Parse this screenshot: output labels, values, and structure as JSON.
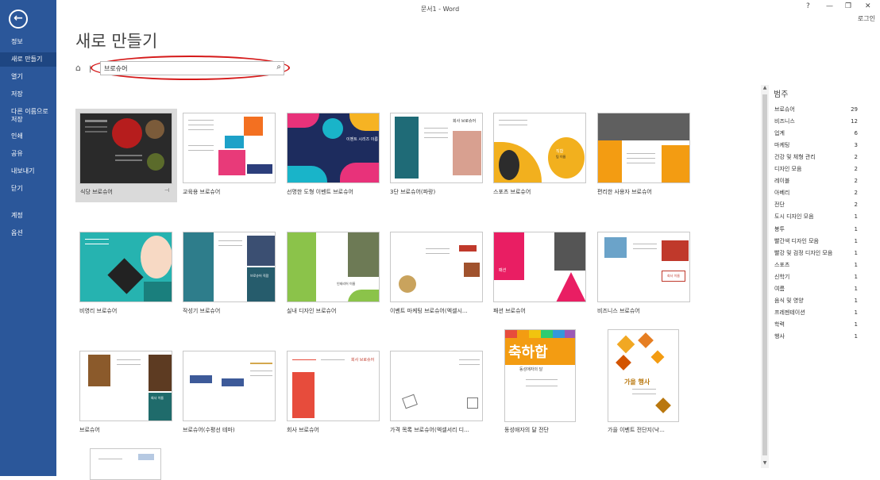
{
  "window": {
    "title": "문서1 - Word",
    "help": "?",
    "minimize": "—",
    "restore": "❐",
    "close": "✕",
    "login": "로그인"
  },
  "sidebar": {
    "back_icon": "←",
    "items": [
      "정보",
      "새로 만들기",
      "열기",
      "저장",
      "다른 이름으로",
      "저장",
      "인쇄",
      "공유",
      "내보내기",
      "닫기",
      "계정",
      "옵션"
    ]
  },
  "page": {
    "title": "새로 만들기",
    "home_icon": "⌂",
    "home_sep": "ㅣ"
  },
  "search": {
    "value": "브로슈어",
    "icon": "⌕"
  },
  "templates": [
    {
      "label": "식당 브로슈어",
      "pin": "⊣"
    },
    {
      "label": "교육용 브로슈어"
    },
    {
      "label": "선명한 도형 이벤트 브로슈어"
    },
    {
      "label": "3단 브로슈어(파랑)"
    },
    {
      "label": "스포츠 브로슈어"
    },
    {
      "label": "편리한 사용자 브로슈어"
    },
    {
      "label": "비영리 브로슈어"
    },
    {
      "label": "작성기 브로슈어"
    },
    {
      "label": "실내 디자인 브로슈어"
    },
    {
      "label": "이벤트 마케팅 브로슈어(엑셀시..."
    },
    {
      "label": "패션 브로슈어"
    },
    {
      "label": "비즈니스 브로슈어"
    },
    {
      "label": "브로슈어"
    },
    {
      "label": "브로슈어(수평선 테마)"
    },
    {
      "label": "회사 브로슈어"
    },
    {
      "label": "가격 목록 브로슈어(엑셀서리 디..."
    },
    {
      "label": "동성애자의 달 전단"
    },
    {
      "label": "가을 이벤트 전단지(낙..."
    }
  ],
  "thumb_text": {
    "event": "이벤트 시리즈 이름",
    "company": "회사 브로슈어",
    "sports_title": "직함",
    "sports_sub": "팀 이름",
    "writer_title": "브로슈어 직함",
    "interior": "인테리어 이름",
    "fashion": "패션",
    "business_name": "회사 이름",
    "brochure_company": "회사 이름",
    "company2": "회사 브로슈어",
    "pride_title": "축하합",
    "pride_sub": "동성애자의 달",
    "fall_title": "가을 행사"
  },
  "categories": {
    "header": "범주",
    "items": [
      {
        "name": "브로슈어",
        "count": "29"
      },
      {
        "name": "비즈니스",
        "count": "12"
      },
      {
        "name": "업계",
        "count": "6"
      },
      {
        "name": "마케팅",
        "count": "3"
      },
      {
        "name": "건강 및 체형 관리",
        "count": "2"
      },
      {
        "name": "디자인 모음",
        "count": "2"
      },
      {
        "name": "레이블",
        "count": "2"
      },
      {
        "name": "아베리",
        "count": "2"
      },
      {
        "name": "전단",
        "count": "2"
      },
      {
        "name": "도시 디자인 모음",
        "count": "1"
      },
      {
        "name": "봉투",
        "count": "1"
      },
      {
        "name": "빨간색 디자인 모음",
        "count": "1"
      },
      {
        "name": "빨강 및 검정 디자인 모음",
        "count": "1"
      },
      {
        "name": "스포츠",
        "count": "1"
      },
      {
        "name": "신학기",
        "count": "1"
      },
      {
        "name": "여름",
        "count": "1"
      },
      {
        "name": "음식 및 영양",
        "count": "1"
      },
      {
        "name": "프레젠테이션",
        "count": "1"
      },
      {
        "name": "학력",
        "count": "1"
      },
      {
        "name": "행사",
        "count": "1"
      }
    ]
  },
  "scroll": {
    "up": "▲",
    "down": "▼"
  }
}
